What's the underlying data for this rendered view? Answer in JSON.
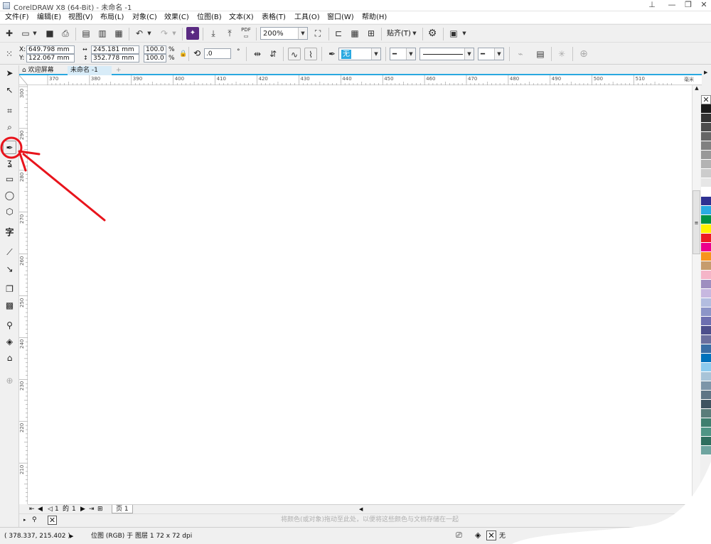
{
  "window": {
    "title": "CorelDRAW X8 (64-Bit) - 未命名 -1",
    "controls": [
      "⊥",
      "—",
      "❐",
      "✕"
    ]
  },
  "menu": [
    "文件(F)",
    "编辑(E)",
    "视图(V)",
    "布局(L)",
    "对象(C)",
    "效果(C)",
    "位图(B)",
    "文本(X)",
    "表格(T)",
    "工具(O)",
    "窗口(W)",
    "帮助(H)"
  ],
  "toolbar": {
    "pdf_label": "PDF",
    "zoom_value": "200%",
    "snap_label": "贴齐(T)"
  },
  "property_bar": {
    "x_label": "X:",
    "x_value": "649.798 mm",
    "y_label": "Y:",
    "y_value": "122.067 mm",
    "width_value": "245.181 mm",
    "height_value": "352.778 mm",
    "scale_w": "100.0",
    "scale_h": "100.0",
    "percent": "%",
    "rotation_value": ".0",
    "degree": "°",
    "fill_value": "无"
  },
  "tabs": {
    "welcome": "欢迎屏幕",
    "document": "未命名 -1",
    "add": "+"
  },
  "ruler": {
    "h_ticks": [
      "370",
      "380",
      "390",
      "400",
      "410",
      "420",
      "430",
      "440",
      "450",
      "460",
      "470",
      "480",
      "490",
      "500",
      "510"
    ],
    "h_units": "毫米",
    "v_ticks": [
      "300",
      "290",
      "280",
      "270",
      "260",
      "250",
      "240",
      "230",
      "220",
      "210"
    ]
  },
  "page_nav": {
    "current": "1",
    "of": "的",
    "total": "1",
    "page_tab": "页 1"
  },
  "doc_palette_hint": "将颜色(或对象)拖动至此处，以便将这些颜色与文档存储在一起",
  "status": {
    "cursor_pos": "( 378.337, 215.402 )",
    "object_info": "位图 (RGB) 于 图层 1 72 x 72 dpi",
    "fill_none": "无",
    "outline_none": "无"
  },
  "palette_colors": [
    "#1a1a1a",
    "#333333",
    "#4d4d4d",
    "#666666",
    "#808080",
    "#999999",
    "#b3b3b3",
    "#cccccc",
    "#e6e6e6",
    "#ffffff",
    "#2e3192",
    "#29abe2",
    "#009245",
    "#fff200",
    "#ed1c24",
    "#ec008c",
    "#f7941d",
    "#c69c6d",
    "#f5b5c8",
    "#9e8ec0",
    "#c7b8e0",
    "#b3bde0",
    "#8c95c8",
    "#6d6fb0",
    "#4d4f8c",
    "#6b6f9e",
    "#3a6ea5",
    "#0072bc",
    "#8ccbee",
    "#a8c4d8",
    "#7d95a8",
    "#5f7585",
    "#3f5360",
    "#5a7d7a",
    "#3f7f6f",
    "#4f9585",
    "#2f6f5f",
    "#6fa5a0"
  ],
  "accent_color": "#29a8e0",
  "annotation_color": "#e8141c"
}
